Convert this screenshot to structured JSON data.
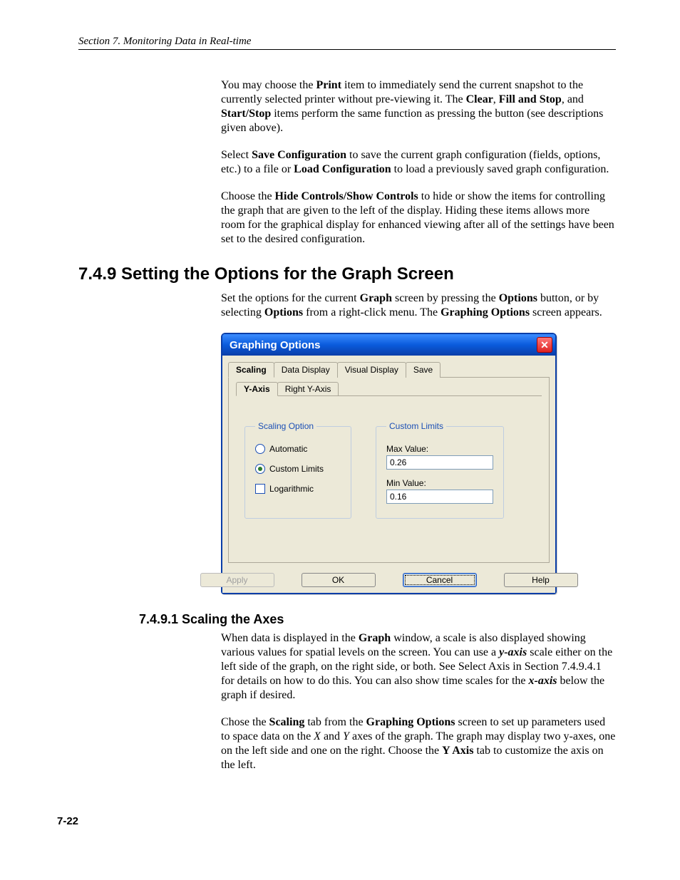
{
  "header": "Section 7.  Monitoring Data in Real-time",
  "para1": {
    "a": "You may choose the ",
    "b": "Print",
    "c": " item to immediately send the current snapshot to the currently selected printer without pre-viewing it.  The ",
    "d": "Clear",
    "e": ", ",
    "f": "Fill and Stop",
    "g": ", and ",
    "h": "Start/Stop",
    "i": " items perform the same function as pressing the button (see descriptions given above)."
  },
  "para2": {
    "a": "Select ",
    "b": "Save Configuration",
    "c": " to save the current graph configuration (fields, options, etc.) to a file or ",
    "d": "Load Configuration",
    "e": " to load a previously saved graph configuration."
  },
  "para3": {
    "a": "Choose the ",
    "b": "Hide Controls/Show Controls",
    "c": " to hide or show the items for controlling the graph that are given to the left of the display.  Hiding these items allows more room for the graphical display for enhanced viewing after all of the settings have been set to the desired configuration."
  },
  "h749": "7.4.9  Setting the Options for the Graph Screen",
  "para4": {
    "a": "Set the options for the current ",
    "b": "Graph",
    "c": " screen by pressing the ",
    "d": "Options",
    "e": " button, or by selecting ",
    "f": "Options",
    "g": " from a right-click menu.  The ",
    "h": "Graphing Options",
    "i": " screen appears."
  },
  "dialog": {
    "title": "Graphing Options",
    "tabs": [
      "Scaling",
      "Data Display",
      "Visual Display",
      "Save"
    ],
    "subtabs": [
      "Y-Axis",
      "Right Y-Axis"
    ],
    "scaling_legend": "Scaling Option",
    "opt_auto": "Automatic",
    "opt_custom": "Custom Limits",
    "opt_log": "Logarithmic",
    "custom_legend": "Custom Limits",
    "max_label": "Max Value:",
    "max_value": "0.26",
    "min_label": "Min Value:",
    "min_value": "0.16",
    "btn_apply": "Apply",
    "btn_ok": "OK",
    "btn_cancel": "Cancel",
    "btn_help": "Help"
  },
  "h7491": "7.4.9.1  Scaling the Axes",
  "para5": {
    "a": "When data is displayed in the ",
    "b": "Graph",
    "c": " window, a scale is also displayed showing various values for spatial levels on the screen.  You can use a ",
    "d": "y-axis",
    "e": " scale either on the left side of the graph, on the right side, or both.  See Select Axis in Section 7.4.9.4.1 for details on how to do this.  You can also show time scales for the ",
    "f": "x-axis",
    "g": " below the graph if desired."
  },
  "para6": {
    "a": "Chose the ",
    "b": "Scaling",
    "c": " tab from the ",
    "d": "Graphing Options",
    "e": " screen to set up parameters used to space data on the ",
    "f": "X",
    "g": " and ",
    "h": "Y",
    "i": " axes of the graph.  The graph may display two y-axes, one on the left side and one on the right.  Choose the ",
    "j": "Y Axis",
    "k": " tab to customize the axis on the left."
  },
  "page_number": "7-22"
}
